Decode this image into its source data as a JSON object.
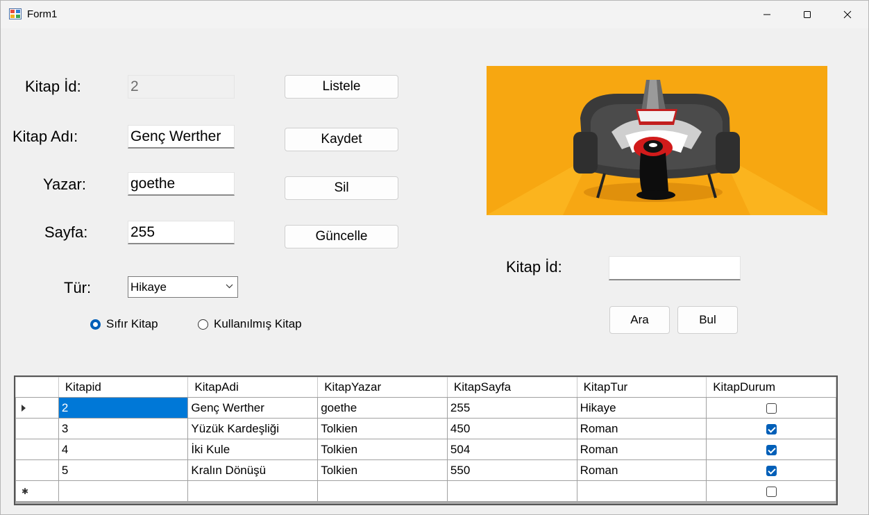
{
  "window": {
    "title": "Form1"
  },
  "form": {
    "labels": {
      "kitap_id": "Kitap İd:",
      "kitap_adi": "Kitap Adı:",
      "yazar": "Yazar:",
      "sayfa": "Sayfa:",
      "tur": "Tür:"
    },
    "fields": {
      "kitap_id": "2",
      "kitap_adi": "Genç Werther",
      "yazar": "goethe",
      "sayfa": "255"
    },
    "tur_select": {
      "selected": "Hikaye"
    },
    "radios": [
      {
        "label": "Sıfır Kitap",
        "checked": true
      },
      {
        "label": "Kullanılmış Kitap",
        "checked": false
      }
    ],
    "buttons": {
      "listele": "Listele",
      "kaydet": "Kaydet",
      "sil": "Sil",
      "guncelle": "Güncelle"
    }
  },
  "search": {
    "label": "Kitap İd:",
    "value": "",
    "ara": "Ara",
    "bul": "Bul"
  },
  "picture": {
    "icon": "person-reading-in-armchair-illustration",
    "background_color": "#f7a711"
  },
  "grid": {
    "columns": [
      "Kitapid",
      "KitapAdi",
      "KitapYazar",
      "KitapSayfa",
      "KitapTur",
      "KitapDurum"
    ],
    "rows": [
      {
        "id": "2",
        "adi": "Genç Werther",
        "yazar": "goethe",
        "sayfa": "255",
        "tur": "Hikaye",
        "durum": false
      },
      {
        "id": "3",
        "adi": "Yüzük Kardeşliği",
        "yazar": "Tolkien",
        "sayfa": "450",
        "tur": "Roman",
        "durum": true
      },
      {
        "id": "4",
        "adi": "İki Kule",
        "yazar": "Tolkien",
        "sayfa": "504",
        "tur": "Roman",
        "durum": true
      },
      {
        "id": "5",
        "adi": "Kralın Dönüşü",
        "yazar": "Tolkien",
        "sayfa": "550",
        "tur": "Roman",
        "durum": true
      }
    ],
    "selection_color": "#0078d7"
  },
  "accent_color": "#005fb8"
}
